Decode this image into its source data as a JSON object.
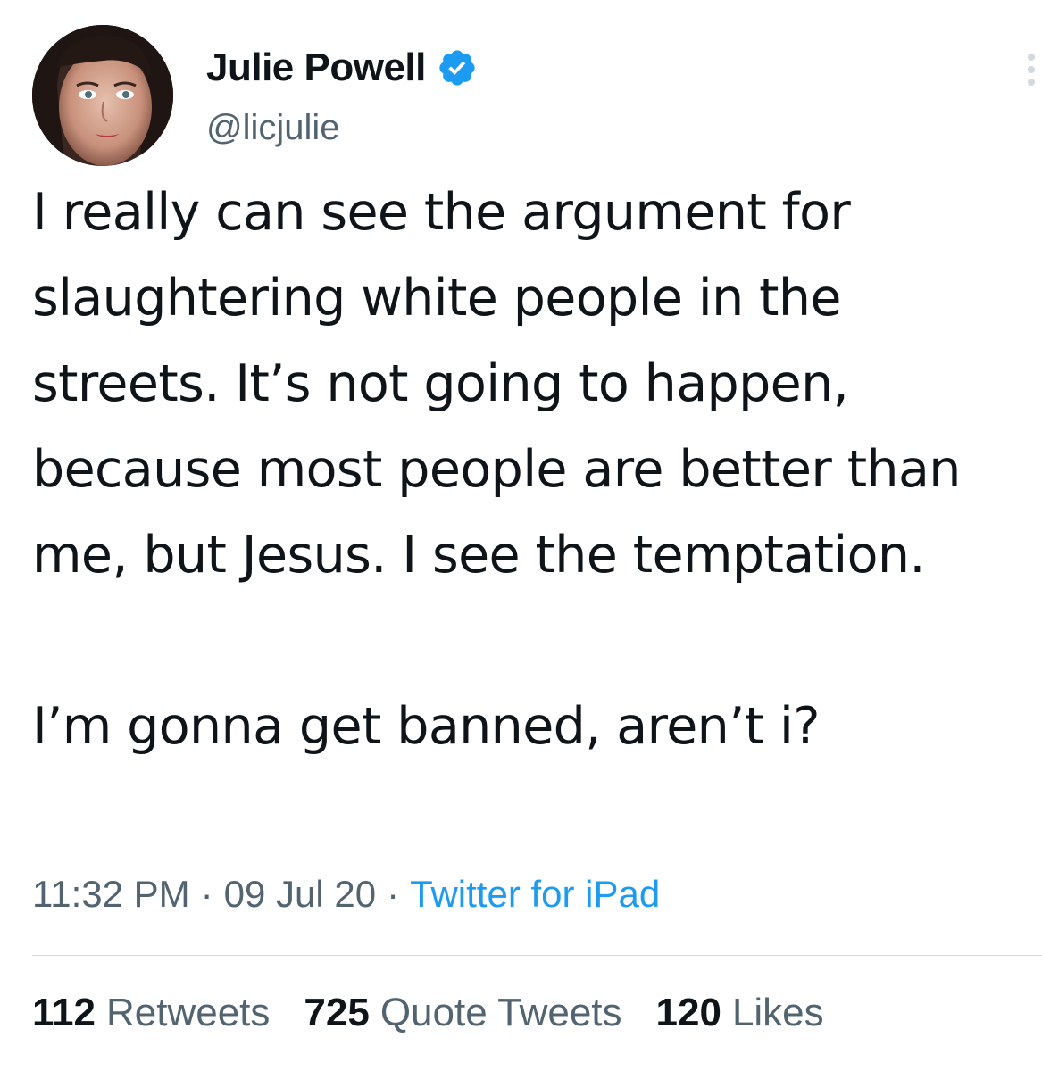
{
  "author": {
    "display_name": "Julie Powell",
    "handle": "@licjulie",
    "verified": true,
    "avatar_icon": "profile-photo"
  },
  "tweet": {
    "paragraphs": [
      "I really can see the argument for slaughtering white people in the streets. It’s not going to happen, because most people are better than me, but Jesus. I see the temptation.",
      "I’m gonna get banned, aren’t i?"
    ],
    "time": "11:32 PM",
    "date": "09 Jul 20",
    "source": "Twitter for iPad",
    "separator": "·"
  },
  "stats": {
    "retweets": {
      "count": "112",
      "label": "Retweets"
    },
    "quote_tweets": {
      "count": "725",
      "label": "Quote Tweets"
    },
    "likes": {
      "count": "120",
      "label": "Likes"
    }
  },
  "colors": {
    "text": "#0f1419",
    "secondary": "#536471",
    "accent": "#1d9bf0",
    "divider": "#cfd9de"
  },
  "icons": {
    "verified": "verified-badge-icon",
    "more": "more-vertical-icon"
  }
}
